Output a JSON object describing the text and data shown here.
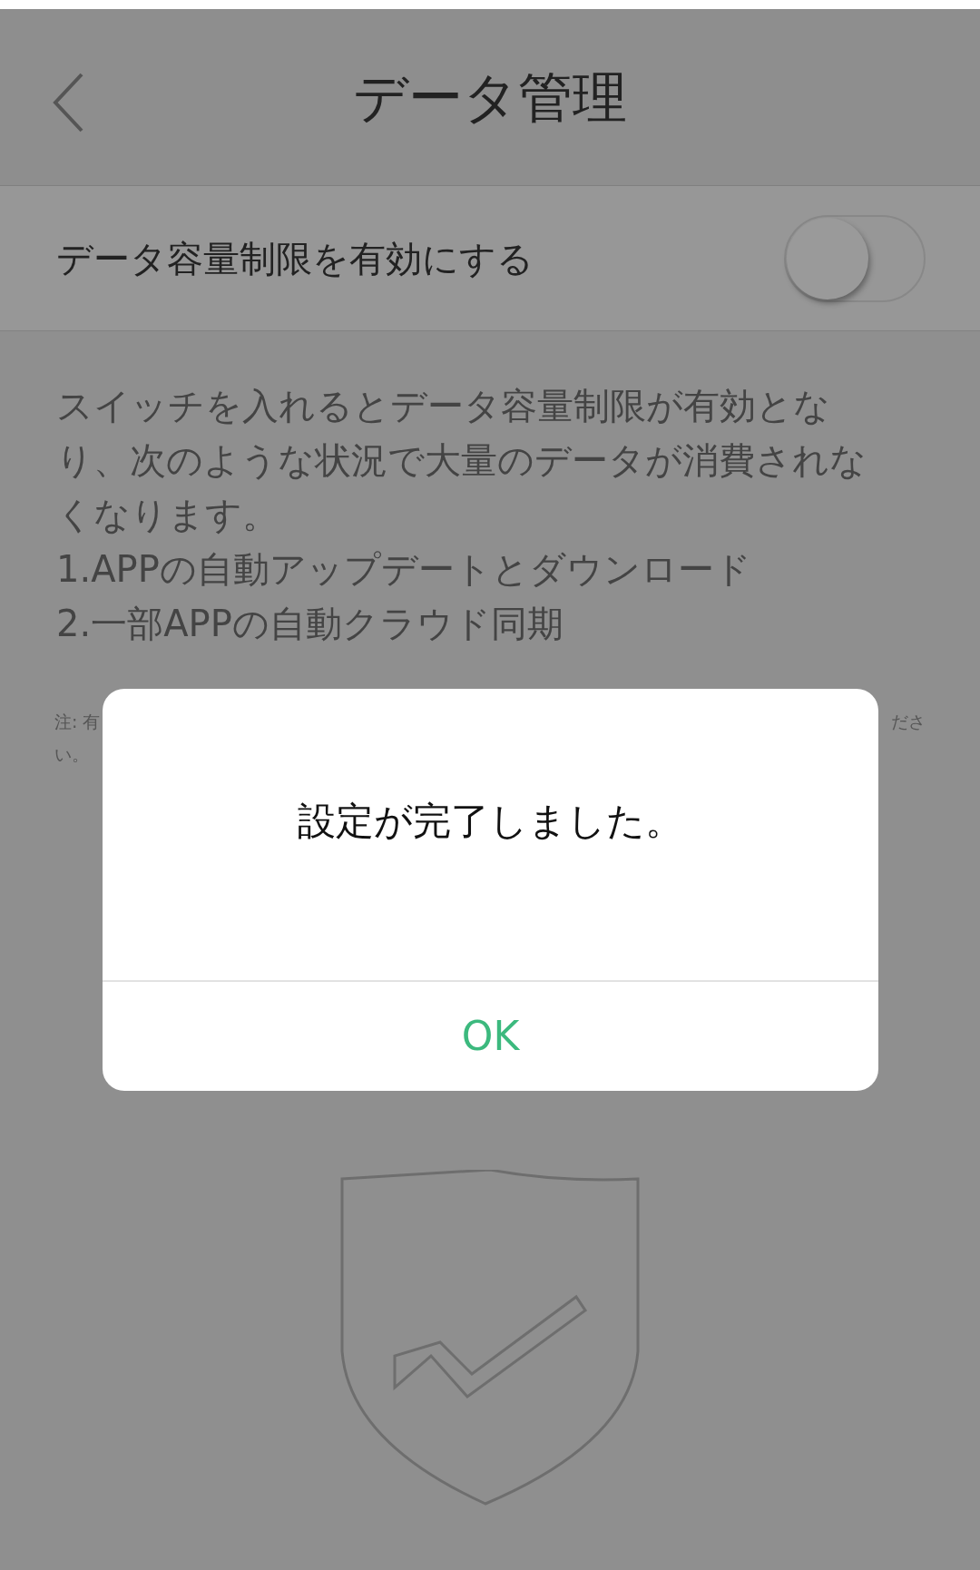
{
  "header": {
    "title": "データ管理"
  },
  "setting": {
    "label": "データ容量制限を有効にする",
    "on": false
  },
  "description": [
    "スイッチを入れるとデータ容量制限が有効となり、次のような状況で大量のデータが消費されなくなります。",
    "1.APPの自動アップデートとダウンロード",
    "2.一部APPの自動クラウド同期"
  ],
  "note": {
    "left": "注: 有",
    "right": "ださ",
    "line_2": "い。"
  },
  "dialog": {
    "message": "設定が完了しました。",
    "button": "OK"
  }
}
